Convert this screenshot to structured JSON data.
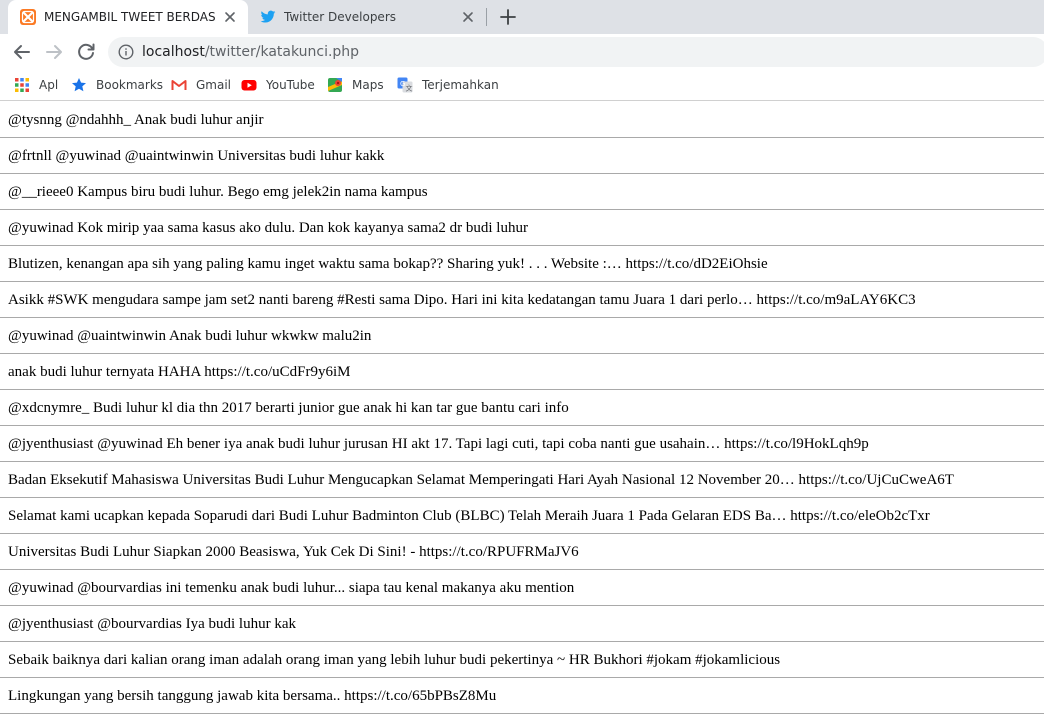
{
  "browser": {
    "tabs": [
      {
        "title": "MENGAMBIL TWEET BERDASARKAN KATA KUNCI",
        "active": true,
        "favicon": "xampp-icon"
      },
      {
        "title": "Twitter Developers",
        "active": false,
        "favicon": "twitter-bird-icon"
      }
    ],
    "address": {
      "host": "localhost",
      "path": "/twitter/katakunci.php"
    },
    "bookmarks": [
      {
        "label": "Apl",
        "icon": "apps-grid-icon"
      },
      {
        "label": "Bookmarks",
        "icon": "star-icon"
      },
      {
        "label": "Gmail",
        "icon": "gmail-icon"
      },
      {
        "label": "YouTube",
        "icon": "youtube-icon"
      },
      {
        "label": "Maps",
        "icon": "maps-icon"
      },
      {
        "label": "Terjemahkan",
        "icon": "translate-icon"
      }
    ]
  },
  "tweets": [
    "@tysnng @ndahhh_ Anak budi luhur anjir",
    "@frtnll @yuwinad @uaintwinwin Universitas budi luhur kakk",
    "@__rieee0 Kampus biru budi luhur. Bego emg jelek2in nama kampus",
    "@yuwinad Kok mirip yaa sama kasus ako dulu. Dan kok kayanya sama2 dr budi luhur",
    "Blutizen, kenangan apa sih yang paling kamu inget waktu sama bokap?? Sharing yuk! . . . Website :… https://t.co/dD2EiOhsie",
    "Asikk #SWK mengudara sampe jam set2 nanti bareng #Resti sama Dipo. Hari ini kita kedatangan tamu Juara 1 dari perlo… https://t.co/m9aLAY6KC3",
    "@yuwinad @uaintwinwin Anak budi luhur wkwkw malu2in",
    "anak budi luhur ternyata HAHA https://t.co/uCdFr9y6iM",
    "@xdcnymre_ Budi luhur kl dia thn 2017 berarti junior gue anak hi kan tar gue bantu cari info",
    "@jyenthusiast @yuwinad Eh bener iya anak budi luhur jurusan HI akt 17. Tapi lagi cuti, tapi coba nanti gue usahain… https://t.co/l9HokLqh9p",
    "Badan Eksekutif Mahasiswa Universitas Budi Luhur Mengucapkan Selamat Memperingati Hari Ayah Nasional 12 November 20… https://t.co/UjCuCweA6T",
    "Selamat kami ucapkan kepada Soparudi dari Budi Luhur Badminton Club (BLBC) Telah Meraih Juara 1 Pada Gelaran EDS Ba… https://t.co/eleOb2cTxr",
    "Universitas Budi Luhur Siapkan 2000 Beasiswa, Yuk Cek Di Sini! - https://t.co/RPUFRMaJV6",
    "@yuwinad @bourvardias ini temenku anak budi luhur... siapa tau kenal makanya aku mention",
    "@jyenthusiast @bourvardias Iya budi luhur kak",
    "Sebaik baiknya dari kalian orang iman adalah orang iman yang lebih luhur budi pekertinya ~ HR Bukhori #jokam #jokamlicious",
    "Lingkungan yang bersih tanggung jawab kita bersama.. https://t.co/65bPBsZ8Mu"
  ],
  "colors": {
    "tabstrip": "#dee1e6",
    "omnibox": "#f1f3f4",
    "divider": "#a9a9a9",
    "twitter_blue": "#1da1f2",
    "xampp_orange": "#fb7a24"
  }
}
